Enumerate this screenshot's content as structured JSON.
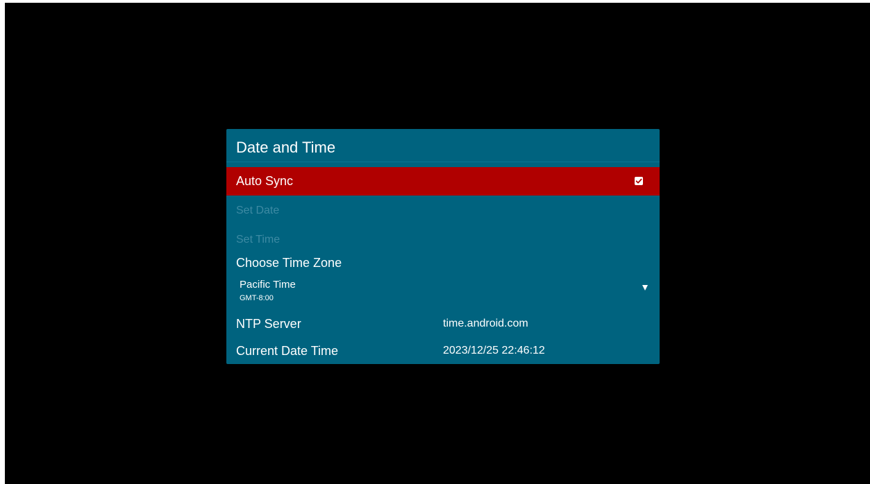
{
  "dialog": {
    "title": "Date and Time",
    "auto_sync": {
      "label": "Auto Sync",
      "checked": true
    },
    "set_date": {
      "label": "Set Date",
      "enabled": false
    },
    "set_time": {
      "label": "Set Time",
      "enabled": false
    },
    "time_zone": {
      "label": "Choose Time Zone",
      "selected_name": "Pacific Time",
      "selected_offset": "GMT-8:00"
    },
    "ntp_server": {
      "label": "NTP Server",
      "value": "time.android.com"
    },
    "current_date_time": {
      "label": "Current Date Time",
      "value": "2023/12/25 22:46:12"
    }
  },
  "colors": {
    "background": "#000000",
    "dialog": "#00637f",
    "focus": "#b00000",
    "disabled_text": "#3d8aa3",
    "text": "#ffffff"
  },
  "icons": {
    "checkbox": "checkbox-checked-icon",
    "dropdown": "triangle-down-icon"
  }
}
